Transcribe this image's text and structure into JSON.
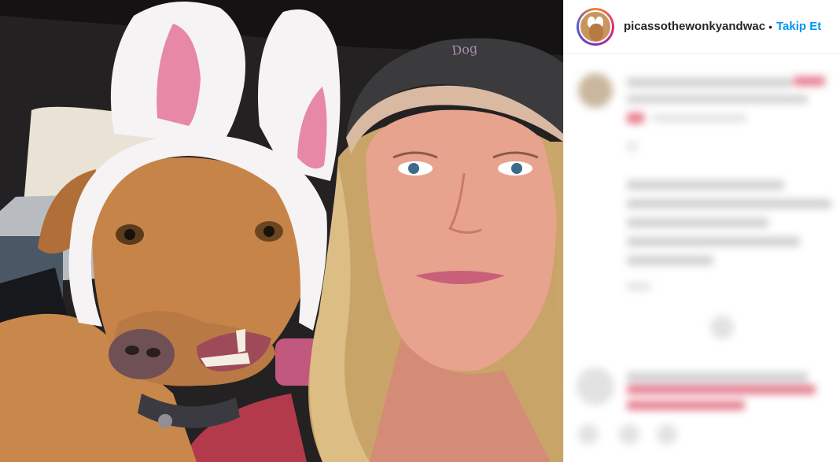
{
  "post": {
    "image_alt": "Selfie of a brown dog wearing white bunny ears next to a blonde woman in a grey cap",
    "cap_text": "Dog"
  },
  "header": {
    "username": "picassothewonkyandwac",
    "separator": "•",
    "follow_label": "Takip Et"
  },
  "colors": {
    "link": "#0095f6",
    "text": "#262626",
    "divider": "#efefef",
    "blurred_link": "#e57c8f"
  },
  "icons": [
    "avatar",
    "heart-icon",
    "comment-icon",
    "share-icon"
  ]
}
